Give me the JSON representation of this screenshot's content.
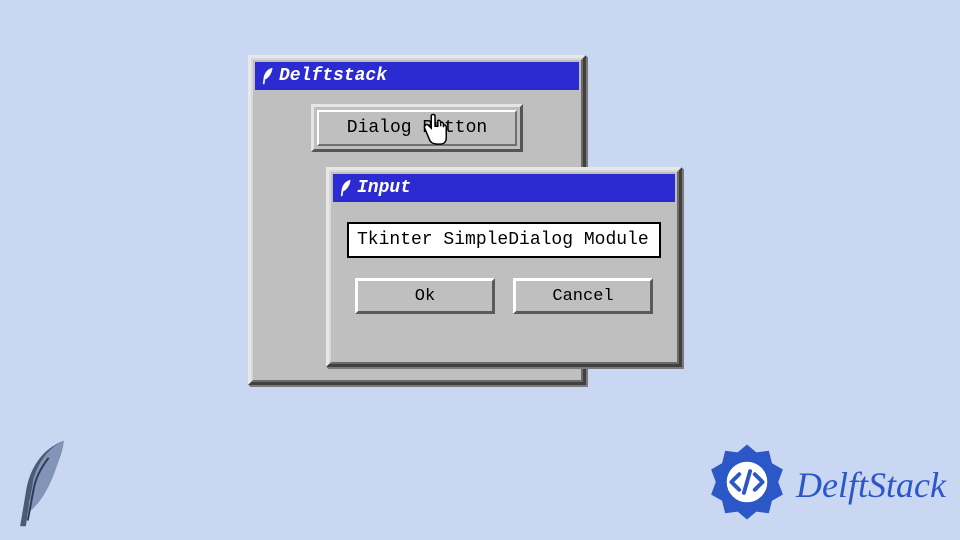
{
  "main_window": {
    "title": "Delftstack",
    "dialog_button_label": "Dialog Button"
  },
  "input_dialog": {
    "title": "Input",
    "field_value": "Tkinter SimpleDialog Module",
    "ok_label": "Ok",
    "cancel_label": "Cancel"
  },
  "brand": {
    "name": "DelftStack"
  },
  "colors": {
    "page_bg": "#c9d7f2",
    "window_bg": "#bfbfbf",
    "titlebar_bg": "#2b2bd1",
    "titlebar_fg": "#ffffff",
    "brand_color": "#2b57c7"
  },
  "icons": {
    "titlebar_icon": "feather-icon",
    "watermark_icon": "feather-icon",
    "cursor": "hand-pointer-icon",
    "brand_mark": "code-badge-icon"
  }
}
